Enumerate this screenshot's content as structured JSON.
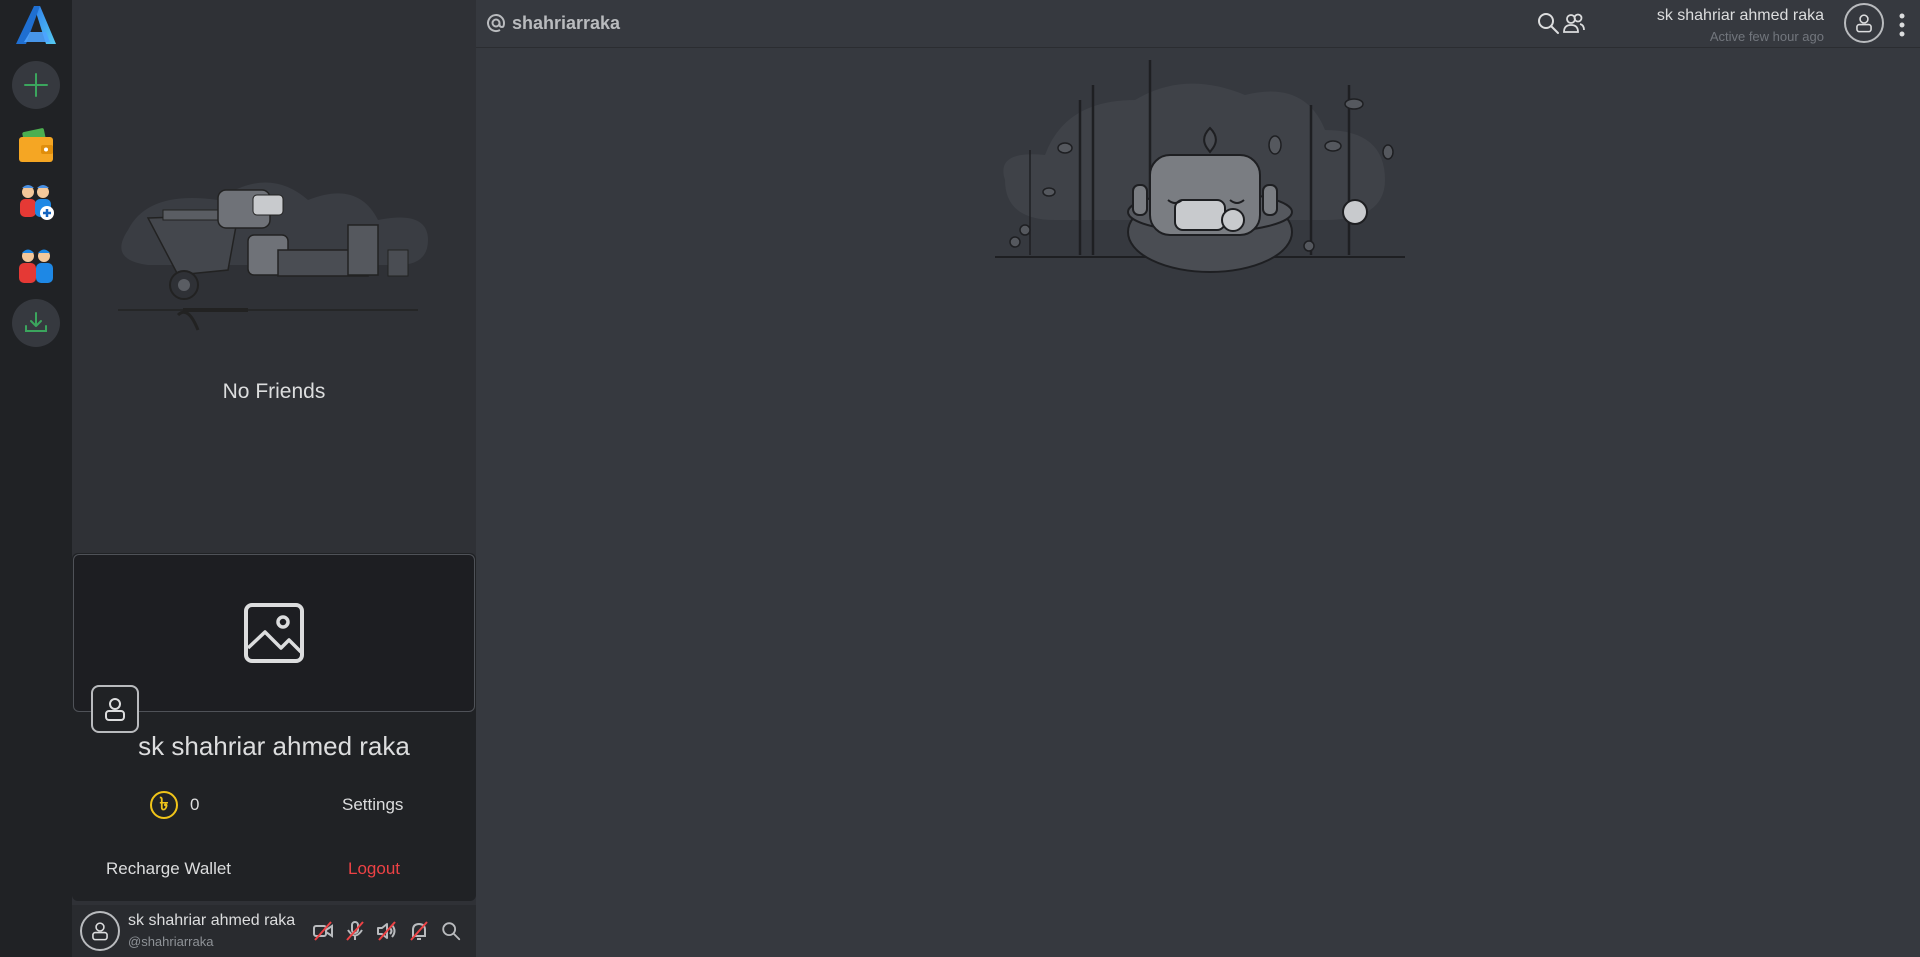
{
  "header": {
    "channel_title": "shahriarraka",
    "user_name": "sk shahriar ahmed raka",
    "user_status": "Active few hour ago"
  },
  "friends": {
    "empty_text": "No Friends"
  },
  "profile_card": {
    "name": "sk shahriar ahmed raka",
    "coin_balance": "0",
    "coin_symbol": "৳",
    "settings_label": "Settings",
    "recharge_label": "Recharge Wallet",
    "logout_label": "Logout"
  },
  "userbar": {
    "name": "sk shahriar ahmed raka",
    "handle": "@shahriarraka"
  },
  "colors": {
    "accent_green": "#3ba55d",
    "logout_red": "#ed4245",
    "coin_yellow": "#f0c419",
    "wallet_orange": "#f5a623"
  }
}
